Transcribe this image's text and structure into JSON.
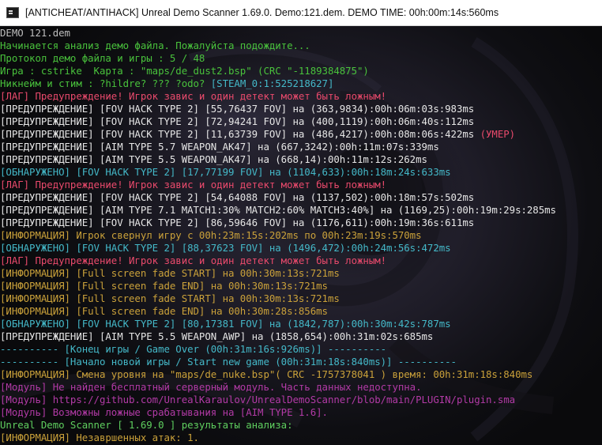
{
  "window": {
    "title": "[ANTICHEAT/ANTIHACK] Unreal Demo Scanner 1.69.0. Demo:121.dem. DEMO TIME: 00h:00m:14s:560ms"
  },
  "colors": {
    "gray": "#bdbdbd",
    "green": "#49c23c",
    "white": "#e6e6e6",
    "red": "#ea4a6c",
    "cyan": "#44b8c8",
    "yellow": "#caa13a",
    "magenta": "#b23aa6",
    "light_green": "#5fcf5f"
  },
  "console": {
    "lines": [
      {
        "parts": [
          {
            "text": "DEMO 121.dem",
            "color": "gray"
          }
        ]
      },
      {
        "parts": [
          {
            "text": "Начинается анализ демо файла. Пожалуйста подождите...",
            "color": "green"
          }
        ]
      },
      {
        "parts": [
          {
            "text": "Протокол демо файла и игры : 5 / 48",
            "color": "green"
          }
        ]
      },
      {
        "parts": [
          {
            "text": "Игра : cstrike  Карта : \"maps/de_dust2.bsp\" (CRC \"-1189384875\")",
            "color": "green"
          }
        ]
      },
      {
        "parts": [
          {
            "text": "Никнейм и стим : ?hildre? ??? ?odo? ",
            "color": "green"
          },
          {
            "text": "[STEAM_0:1:525218627]",
            "color": "cyan"
          }
        ]
      },
      {
        "parts": [
          {
            "text": "[ЛАГ] Предупреждение! Игрок завис и один детект может быть ложным!",
            "color": "red"
          }
        ]
      },
      {
        "parts": [
          {
            "text": "[ПРЕДУПРЕЖДЕНИЕ] [FOV HACK TYPE 2] [55,76437 FOV] на (363,9834):00h:06m:03s:983ms",
            "color": "white"
          }
        ]
      },
      {
        "parts": [
          {
            "text": "[ПРЕДУПРЕЖДЕНИЕ] [FOV HACK TYPE 2] [72,94241 FOV] на (400,1119):00h:06m:40s:112ms",
            "color": "white"
          }
        ]
      },
      {
        "parts": [
          {
            "text": "[ПРЕДУПРЕЖДЕНИЕ] [FOV HACK TYPE 2] [11,63739 FOV] на (486,4217):00h:08m:06s:422ms ",
            "color": "white"
          },
          {
            "text": "(УМЕР)",
            "color": "red"
          }
        ]
      },
      {
        "parts": [
          {
            "text": "[ПРЕДУПРЕЖДЕНИЕ] [AIM TYPE 5.7 WEAPON_AK47] на (667,3242):00h:11m:07s:339ms",
            "color": "white"
          }
        ]
      },
      {
        "parts": [
          {
            "text": "[ПРЕДУПРЕЖДЕНИЕ] [AIM TYPE 5.5 WEAPON_AK47] на (668,14):00h:11m:12s:262ms",
            "color": "white"
          }
        ]
      },
      {
        "parts": [
          {
            "text": "[ОБНАРУЖЕНО] [FOV HACK TYPE 2] [17,77199 FOV] на (1104,633):00h:18m:24s:633ms",
            "color": "cyan"
          }
        ]
      },
      {
        "parts": [
          {
            "text": "[ЛАГ] Предупреждение! Игрок завис и один детект может быть ложным!",
            "color": "red"
          }
        ]
      },
      {
        "parts": [
          {
            "text": "[ПРЕДУПРЕЖДЕНИЕ] [FOV HACK TYPE 2] [54,64088 FOV] на (1137,502):00h:18m:57s:502ms",
            "color": "white"
          }
        ]
      },
      {
        "parts": [
          {
            "text": "[ПРЕДУПРЕЖДЕНИЕ] [AIM TYPE 7.1 MATCH1:30% MATCH2:60% MATCH3:40%] на (1169,25):00h:19m:29s:285ms",
            "color": "white"
          }
        ]
      },
      {
        "parts": [
          {
            "text": "[ПРЕДУПРЕЖДЕНИЕ] [FOV HACK TYPE 2] [86,59646 FOV] на (1176,611):00h:19m:36s:611ms",
            "color": "white"
          }
        ]
      },
      {
        "parts": [
          {
            "text": "[ИНФОРМАЦИЯ] Игрок свернул игру с 00h:23m:15s:202ms по 00h:23m:19s:570ms",
            "color": "yellow"
          }
        ]
      },
      {
        "parts": [
          {
            "text": "[ОБНАРУЖЕНО] [FOV HACK TYPE 2] [88,37623 FOV] на (1496,472):00h:24m:56s:472ms",
            "color": "cyan"
          }
        ]
      },
      {
        "parts": [
          {
            "text": "[ЛАГ] Предупреждение! Игрок завис и один детект может быть ложным!",
            "color": "red"
          }
        ]
      },
      {
        "parts": [
          {
            "text": "[ИНФОРМАЦИЯ] [Full screen fade START] на 00h:30m:13s:721ms",
            "color": "yellow"
          }
        ]
      },
      {
        "parts": [
          {
            "text": "[ИНФОРМАЦИЯ] [Full screen fade END] на 00h:30m:13s:721ms",
            "color": "yellow"
          }
        ]
      },
      {
        "parts": [
          {
            "text": "[ИНФОРМАЦИЯ] [Full screen fade START] на 00h:30m:13s:721ms",
            "color": "yellow"
          }
        ]
      },
      {
        "parts": [
          {
            "text": "[ИНФОРМАЦИЯ] [Full screen fade END] на 00h:30m:28s:856ms",
            "color": "yellow"
          }
        ]
      },
      {
        "parts": [
          {
            "text": "[ОБНАРУЖЕНО] [FOV HACK TYPE 2] [80,17381 FOV] на (1842,787):00h:30m:42s:787ms",
            "color": "cyan"
          }
        ]
      },
      {
        "parts": [
          {
            "text": "[ПРЕДУПРЕЖДЕНИЕ] [AIM TYPE 5.5 WEAPON_AWP] на (1858,654):00h:31m:02s:685ms",
            "color": "white"
          }
        ]
      },
      {
        "parts": [
          {
            "text": "---------- [Конец игры / Game Over (00h:31m:16s:926ms)] ----------",
            "color": "cyan"
          }
        ]
      },
      {
        "parts": [
          {
            "text": "---------- [Начало новой игры / Start new game (00h:31m:18s:840ms)] ----------",
            "color": "cyan"
          }
        ]
      },
      {
        "parts": [
          {
            "text": "[ИНФОРМАЦИЯ] Смена уровня на \"maps/de_nuke.bsp\"( CRC -1757378041 ) время: 00h:31m:18s:840ms",
            "color": "yellow"
          }
        ]
      },
      {
        "parts": [
          {
            "text": "[Модуль] Не найден бесплатный серверный модуль. Часть данных недоступна.",
            "color": "magenta"
          }
        ]
      },
      {
        "parts": [
          {
            "text": "[Модуль] https://github.com/UnrealKaraulov/UnrealDemoScanner/blob/main/PLUGIN/plugin.sma",
            "color": "magenta"
          }
        ]
      },
      {
        "parts": [
          {
            "text": "[Модуль] Возможны ложные срабатывания на [AIM TYPE 1.6].",
            "color": "magenta"
          }
        ]
      },
      {
        "parts": [
          {
            "text": "Unreal Demo Scanner [ 1.69.0 ] результаты анализа:",
            "color": "light_green"
          }
        ]
      },
      {
        "parts": [
          {
            "text": "[ИНФОРМАЦИЯ] Незавршенных атак: 1.",
            "color": "yellow"
          }
        ]
      }
    ]
  }
}
